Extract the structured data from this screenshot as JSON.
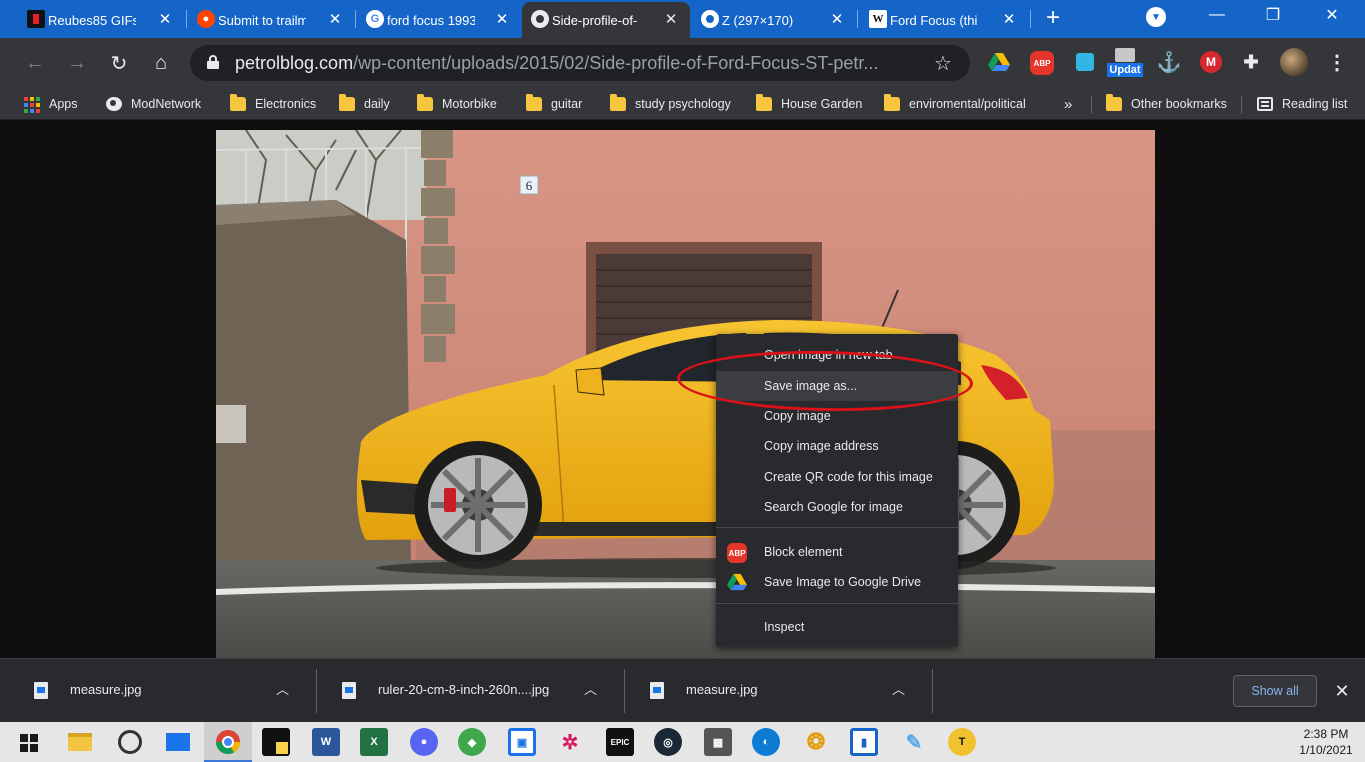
{
  "browser": {
    "tabs": [
      {
        "title": "Reubes85 GIFs -",
        "icon": "black-square-icon"
      },
      {
        "title": "Submit to trailm",
        "icon": "reddit-icon"
      },
      {
        "title": "ford focus 1993",
        "icon": "google-icon"
      },
      {
        "title": "Side-profile-of-",
        "icon": "globe-icon",
        "active": true
      },
      {
        "title": "Z (297×170)",
        "icon": "globe-icon"
      },
      {
        "title": "Ford Focus (thi",
        "icon": "wikipedia-icon"
      }
    ],
    "url_host": "petrolblog.com",
    "url_path": "/wp-content/uploads/2015/02/Side-profile-of-Ford-Focus-ST-petr...",
    "extensions": [
      {
        "name": "google-drive-icon",
        "label": ""
      },
      {
        "name": "abp-icon",
        "label": "ABP"
      },
      {
        "name": "share-icon",
        "label": ""
      },
      {
        "name": "update-icon",
        "label": "Updat"
      },
      {
        "name": "anchor-icon",
        "label": ""
      },
      {
        "name": "mega-icon",
        "label": "M"
      },
      {
        "name": "puzzle-icon",
        "label": ""
      }
    ]
  },
  "bookmarks": [
    {
      "label": "Apps",
      "icon": "apps-grid-icon"
    },
    {
      "label": "ModNetwork",
      "icon": "globe-icon"
    },
    {
      "label": "Electronics",
      "icon": "folder-icon"
    },
    {
      "label": "daily",
      "icon": "folder-icon"
    },
    {
      "label": "Motorbike",
      "icon": "folder-icon"
    },
    {
      "label": "guitar",
      "icon": "folder-icon"
    },
    {
      "label": "study psychology",
      "icon": "folder-icon"
    },
    {
      "label": "House Garden",
      "icon": "folder-icon"
    },
    {
      "label": "enviromental/political",
      "icon": "folder-icon"
    }
  ],
  "bookmarks_overflow": "»",
  "other_bookmarks": "Other bookmarks",
  "reading_list": "Reading list",
  "photo": {
    "house_number": "6"
  },
  "context_menu": {
    "items": [
      {
        "label": "Open image in new tab"
      },
      {
        "label": "Save image as...",
        "highlighted": true
      },
      {
        "label": "Copy image"
      },
      {
        "label": "Copy image address"
      },
      {
        "label": "Create QR code for this image"
      },
      {
        "label": "Search Google for image"
      },
      {
        "label": "Block element",
        "icon": "abp-icon",
        "icon_label": "ABP"
      },
      {
        "label": "Save Image to Google Drive",
        "icon": "google-drive-icon"
      },
      {
        "label": "Inspect"
      }
    ]
  },
  "downloads": [
    {
      "name": "measure.jpg"
    },
    {
      "name": "ruler-20-cm-8-inch-260n....jpg"
    },
    {
      "name": "measure.jpg"
    }
  ],
  "show_all_label": "Show all",
  "taskbar": {
    "time": "2:38 PM",
    "date": "1/10/2021",
    "epic_label": "EPIC",
    "word_label": "W",
    "excel_label": "X"
  },
  "colors": {
    "tab_strip": "#1565c8",
    "toolbar": "#35363a",
    "highlight_ellipse": "#d81218",
    "car_yellow": "#f2b417"
  }
}
